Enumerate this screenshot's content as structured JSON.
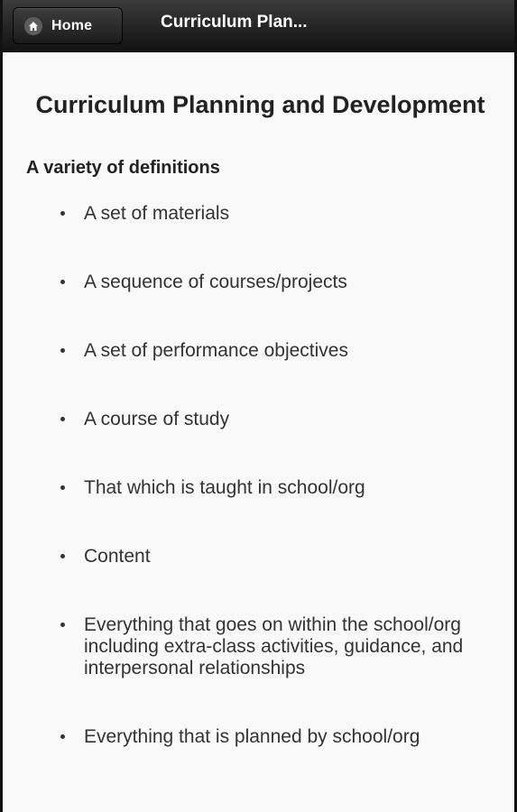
{
  "header": {
    "home_label": "Home",
    "title": "Curriculum Plan..."
  },
  "main": {
    "heading": "Curriculum Planning and Development",
    "subheading": "A variety of definitions",
    "items": [
      "A set of materials",
      "A sequence of courses/projects",
      "A set of performance objectives",
      "A course of study",
      "That which is taught in school/org",
      "Content",
      "Everything that goes on within the school/org including extra-class activities, guidance, and interpersonal relationships",
      "Everything that is planned by school/org"
    ]
  },
  "icons": {
    "home": "home-icon"
  }
}
